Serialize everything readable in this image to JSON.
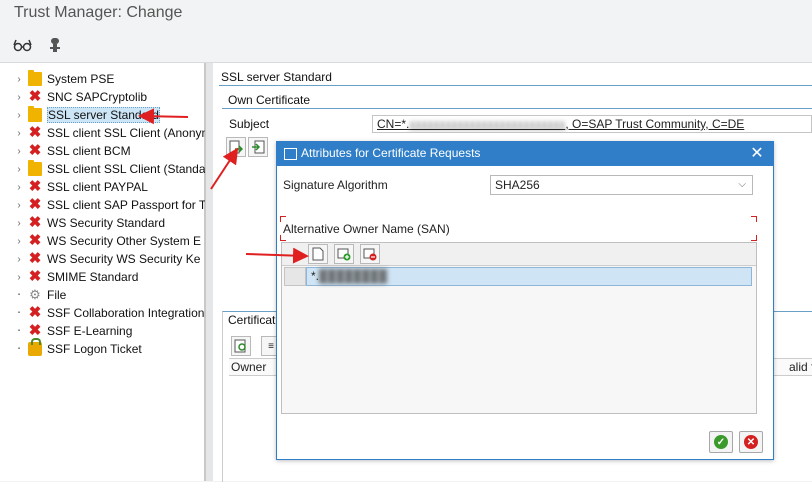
{
  "window": {
    "title": "Trust Manager: Change"
  },
  "toolbar": {
    "buttons": [
      {
        "icon": "glasses-icon"
      },
      {
        "icon": "pse-key-icon"
      }
    ]
  },
  "tree": {
    "items": [
      {
        "label": "System PSE",
        "icon": "folder-icon",
        "expandable": true
      },
      {
        "label": "SNC SAPCryptolib",
        "icon": "error-x-icon",
        "expandable": true
      },
      {
        "label": "SSL server Standard",
        "icon": "folder-icon",
        "expandable": true,
        "selected": true
      },
      {
        "label": "SSL client SSL Client (Anonym",
        "icon": "error-x-icon",
        "expandable": true
      },
      {
        "label": "SSL client BCM",
        "icon": "error-x-icon",
        "expandable": true
      },
      {
        "label": "SSL client SSL Client (Standa",
        "icon": "folder-icon",
        "expandable": true
      },
      {
        "label": "SSL client PAYPAL",
        "icon": "error-x-icon",
        "expandable": true
      },
      {
        "label": "SSL client SAP Passport for T",
        "icon": "error-x-icon",
        "expandable": true
      },
      {
        "label": "WS Security Standard",
        "icon": "error-x-icon",
        "expandable": true
      },
      {
        "label": "WS Security Other System E",
        "icon": "error-x-icon",
        "expandable": true
      },
      {
        "label": "WS Security WS Security Ke",
        "icon": "error-x-icon",
        "expandable": true
      },
      {
        "label": "SMIME Standard",
        "icon": "error-x-icon",
        "expandable": true
      },
      {
        "label": "File",
        "icon": "gear-icon",
        "expandable": false
      },
      {
        "label": "SSF Collaboration Integration",
        "icon": "error-x-icon",
        "expandable": false
      },
      {
        "label": "SSF E-Learning",
        "icon": "error-x-icon",
        "expandable": false
      },
      {
        "label": "SSF Logon Ticket",
        "icon": "lock-icon",
        "expandable": false
      }
    ]
  },
  "main": {
    "section_title": "SSL server Standard",
    "own_cert": {
      "title": "Own Certificate",
      "subject_label": "Subject",
      "subject_value": "CN=*.██████████████, O=SAP Trust Community, C=DE",
      "subject_prefix": "CN=*.",
      "subject_suffix": ", O=SAP Trust Community, C=DE"
    },
    "cert_list": {
      "title_fragment": "Certificat",
      "owner_col": "Owner",
      "valid_from_col": "alid from"
    }
  },
  "dialog": {
    "title": "Attributes for Certificate Requests",
    "sig_label": "Signature Algorithm",
    "sig_value": "SHA256",
    "san_label": "Alternative Owner Name (SAN)",
    "san_rows": [
      {
        "prefix": "*.",
        "value": "████████"
      }
    ],
    "ok_icon": "check-icon",
    "cancel_icon": "cancel-icon"
  },
  "colors": {
    "accent": "#2f7ec7",
    "error": "#d42020",
    "folder": "#f0b400",
    "annotation_arrow": "#e02020"
  }
}
